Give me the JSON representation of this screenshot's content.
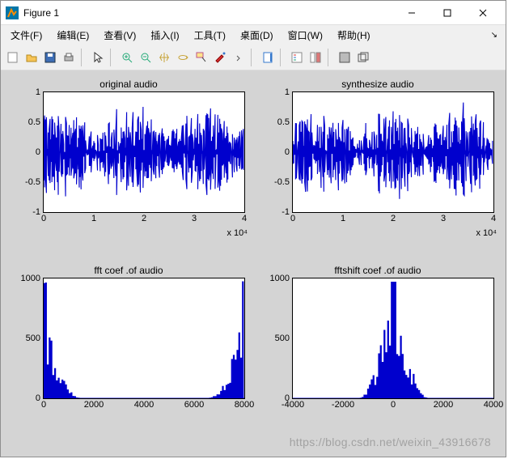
{
  "window": {
    "title": "Figure 1",
    "min_tip": "minimize",
    "max_tip": "maximize",
    "close_tip": "close"
  },
  "menu": {
    "file": "文件(F)",
    "edit": "编辑(E)",
    "view": "查看(V)",
    "insert": "插入(I)",
    "tools": "工具(T)",
    "desktop": "桌面(D)",
    "window": "窗口(W)",
    "help": "帮助(H)"
  },
  "watermark": "https://blog.csdn.net/weixin_43916678",
  "chart_data": [
    {
      "type": "line",
      "title": "original audio",
      "xlim": [
        0,
        40000
      ],
      "ylim": [
        -1,
        1
      ],
      "xticks": [
        0,
        10000,
        20000,
        30000,
        40000
      ],
      "xticklabels": [
        "0",
        "1",
        "2",
        "3",
        "4"
      ],
      "xexp": "x 10⁴",
      "yticks": [
        -1,
        -0.5,
        0,
        0.5,
        1
      ],
      "series_kind": "audio-waveform",
      "n_samples": 40000,
      "peak_abs": 1.0
    },
    {
      "type": "line",
      "title": "synthesize audio",
      "xlim": [
        0,
        40000
      ],
      "ylim": [
        -1,
        1
      ],
      "xticks": [
        0,
        10000,
        20000,
        30000,
        40000
      ],
      "xticklabels": [
        "0",
        "1",
        "2",
        "3",
        "4"
      ],
      "xexp": "x 10⁴",
      "yticks": [
        -1,
        -0.5,
        0,
        0.5,
        1
      ],
      "series_kind": "audio-waveform",
      "n_samples": 40000,
      "peak_abs": 1.0
    },
    {
      "type": "line",
      "title": "fft coef .of audio",
      "xlim": [
        0,
        8000
      ],
      "ylim": [
        0,
        1000
      ],
      "xticks": [
        0,
        2000,
        4000,
        6000,
        8000
      ],
      "xticklabels": [
        "0",
        "2000",
        "4000",
        "6000",
        "8000"
      ],
      "yticks": [
        0,
        500,
        1000
      ],
      "series_kind": "spectrum",
      "shape": "energy concentrated at low (<1500) and high (>7000) edges, valley in middle",
      "peak_value": 1000
    },
    {
      "type": "line",
      "title": "fftshift coef .of audio",
      "xlim": [
        -4000,
        4000
      ],
      "ylim": [
        0,
        1000
      ],
      "xticks": [
        -4000,
        -2000,
        0,
        2000,
        4000
      ],
      "xticklabels": [
        "-4000",
        "-2000",
        "0",
        "2000",
        "4000"
      ],
      "yticks": [
        0,
        500,
        1000
      ],
      "series_kind": "spectrum-centered",
      "shape": "symmetric, energy concentrated near 0, tapering to ±2000",
      "peak_value": 1000
    }
  ]
}
